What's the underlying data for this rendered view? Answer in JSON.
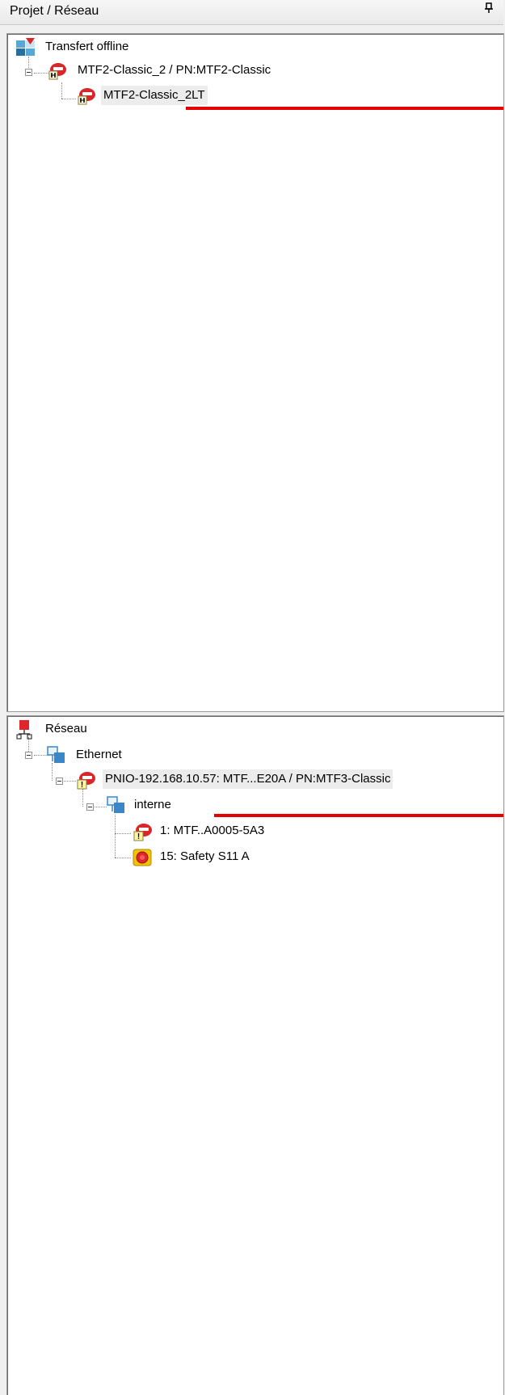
{
  "panel": {
    "title": "Projet / Réseau",
    "pin_glyph": "ᵖ"
  },
  "top_tree": {
    "root": {
      "label": "Transfert offline",
      "icon": "offline-transfer-icon"
    },
    "device": {
      "label": "MTF2-Classic_2 / PN:MTF2-Classic",
      "icon": "device-icon"
    },
    "child": {
      "label": "MTF2-Classic_2LT",
      "icon": "device-icon",
      "selected": true
    }
  },
  "bottom_tree": {
    "root": {
      "label": "Réseau",
      "icon": "network-icon"
    },
    "ethernet": {
      "label": "Ethernet",
      "icon": "network-segment-icon"
    },
    "pnio": {
      "label": "PNIO-192.168.10.57: MTF...E20A / PN:MTF3-Classic",
      "icon": "device-warning-icon",
      "selected": true
    },
    "interne": {
      "label": "interne",
      "icon": "network-segment-icon"
    },
    "module1": {
      "label": "1: MTF..A0005-5A3",
      "icon": "device-warning-icon"
    },
    "module15": {
      "label": "15: Safety S11 A",
      "icon": "safety-button-icon"
    }
  },
  "colors": {
    "annotation_line": "#e50000",
    "device_red": "#d8262b",
    "network_blue": "#3a86c8"
  }
}
